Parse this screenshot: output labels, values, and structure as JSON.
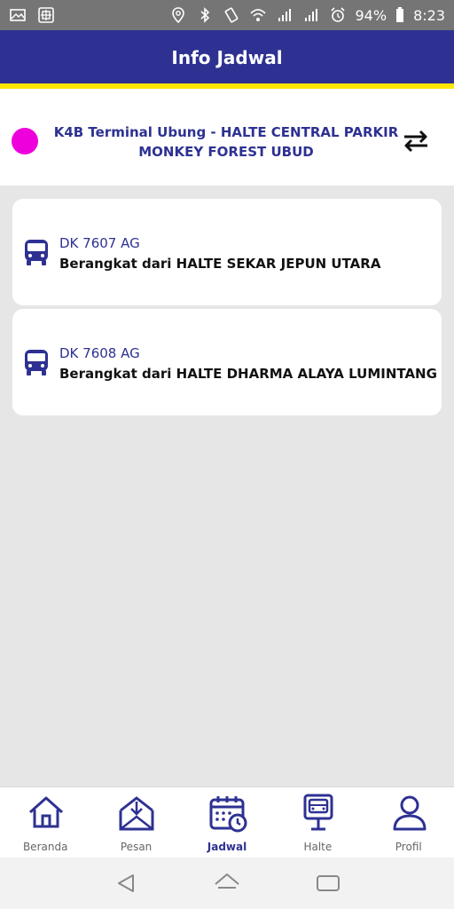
{
  "status_bar": {
    "battery": "94%",
    "time": "8:23",
    "icons": [
      "image-icon",
      "screen-mirror-icon",
      "location-icon",
      "bluetooth-icon",
      "vibrate-icon",
      "wifi-icon",
      "signal-icon-1",
      "signal-icon-2",
      "alarm-icon",
      "battery-icon"
    ]
  },
  "header": {
    "title": "Info Jadwal",
    "color": "#2e3192",
    "accent_color": "#ffe600"
  },
  "route": {
    "dot_color": "#ee00dd",
    "name": "K4B Terminal Ubung - HALTE CENTRAL PARKIR MONKEY FOREST UBUD",
    "swap_icon": "swap-arrows-icon"
  },
  "schedules": [
    {
      "icon": "bus-icon",
      "plate": "DK 7607 AG",
      "departure": "Berangkat dari HALTE SEKAR JEPUN UTARA"
    },
    {
      "icon": "bus-icon",
      "plate": "DK 7608 AG",
      "departure": "Berangkat dari HALTE DHARMA ALAYA LUMINTANG"
    }
  ],
  "bottom_nav": [
    {
      "label": "Beranda",
      "icon": "home-icon",
      "active": false
    },
    {
      "label": "Pesan",
      "icon": "inbox-icon",
      "active": false
    },
    {
      "label": "Jadwal",
      "icon": "calendar-clock-icon",
      "active": true
    },
    {
      "label": "Halte",
      "icon": "bus-stop-icon",
      "active": false
    },
    {
      "label": "Profil",
      "icon": "profile-icon",
      "active": false
    }
  ],
  "system_nav": {
    "icons": [
      "back-icon",
      "home-outline-icon",
      "recents-icon"
    ]
  }
}
